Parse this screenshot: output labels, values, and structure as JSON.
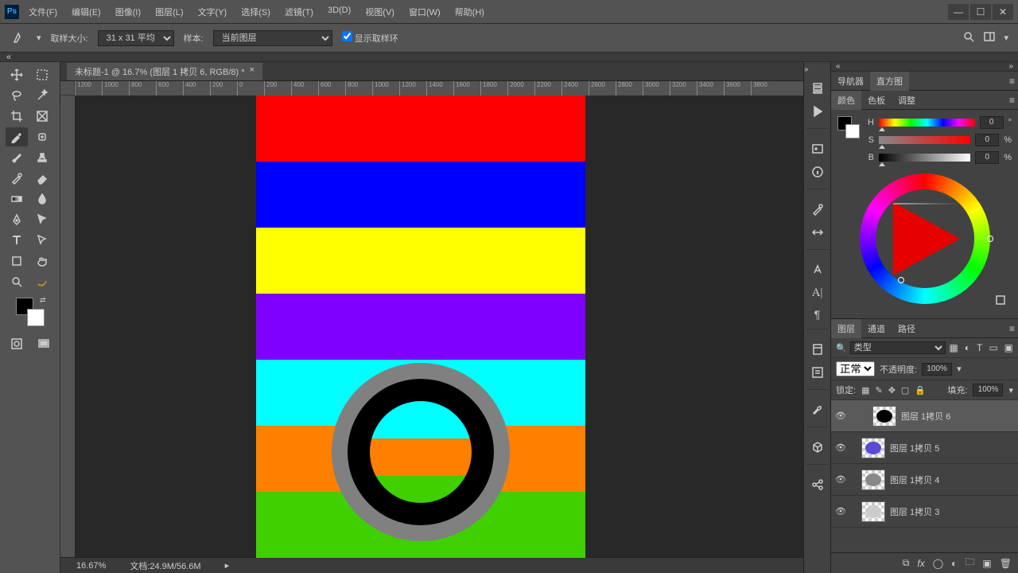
{
  "menubar": {
    "logo": "Ps",
    "items": [
      "文件(F)",
      "编辑(E)",
      "图像(I)",
      "图层(L)",
      "文字(Y)",
      "选择(S)",
      "滤镜(T)",
      "3D(D)",
      "视图(V)",
      "窗口(W)",
      "帮助(H)"
    ]
  },
  "options": {
    "sample_size_label": "取样大小:",
    "sample_size_value": "31 x 31 平均",
    "sample_label": "样本:",
    "sample_value": "当前图层",
    "show_ring": "显示取样环"
  },
  "doc": {
    "tab_title": "未标题-1 @ 16.7% (图层 1 拷贝 6, RGB/8) *",
    "ruler_ticks": [
      "1200",
      "1000",
      "800",
      "600",
      "400",
      "200",
      "0",
      "200",
      "400",
      "600",
      "800",
      "1000",
      "1200",
      "1400",
      "1600",
      "1800",
      "2000",
      "2200",
      "2400",
      "2600",
      "2800",
      "3000",
      "3200",
      "3400",
      "3600",
      "3800"
    ]
  },
  "status": {
    "zoom": "16.67%",
    "doc": "文档:24.9M/56.6M"
  },
  "nav_tabs": {
    "navigator": "导航器",
    "histogram": "直方图"
  },
  "color_tabs": {
    "color": "颜色",
    "swatch": "色板",
    "adjust": "调整"
  },
  "hsb": {
    "h_label": "H",
    "h": "0",
    "h_unit": "°",
    "s_label": "S",
    "s": "0",
    "s_unit": "%",
    "b_label": "B",
    "b": "0",
    "b_unit": "%"
  },
  "layer_tabs": {
    "layers": "图层",
    "channels": "通道",
    "paths": "路径"
  },
  "layer_opts": {
    "kind": "类型",
    "blend": "正常",
    "opacity_label": "不透明度:",
    "opacity": "100%",
    "lock_label": "锁定:",
    "fill_label": "填充:",
    "fill": "100%"
  },
  "layers": [
    {
      "name": "图层 1拷贝 6",
      "active": true,
      "thumb": "#000"
    },
    {
      "name": "图层 1拷贝 5",
      "active": false,
      "thumb": "#5a4bd4"
    },
    {
      "name": "图层 1拷贝 4",
      "active": false,
      "thumb": "#888"
    },
    {
      "name": "图层 1拷贝 3",
      "active": false,
      "thumb": "#ccc"
    }
  ],
  "artwork": {
    "stripes": [
      "#ff0000",
      "#0000ff",
      "#ffff00",
      "#8000ff",
      "#00ffff",
      "#ff8000",
      "#40d000"
    ]
  }
}
